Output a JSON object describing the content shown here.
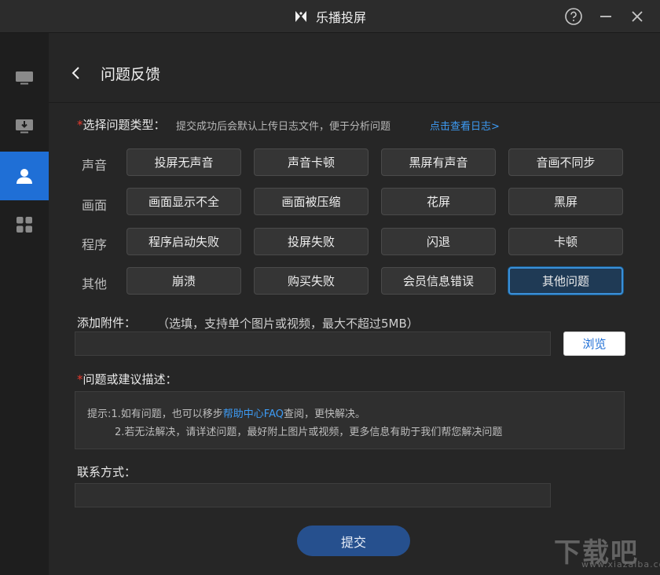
{
  "window": {
    "title": "乐播投屏",
    "logo_icon": "lebo-logo-icon",
    "controls": [
      "help-icon",
      "minimize-icon",
      "close-icon"
    ]
  },
  "sidebar": {
    "items": [
      {
        "icon": "monitor-icon",
        "active": false
      },
      {
        "icon": "download-monitor-icon",
        "active": false
      },
      {
        "icon": "user-icon",
        "active": true
      },
      {
        "icon": "apps-grid-icon",
        "active": false
      }
    ],
    "active_color": "#1f6fd6"
  },
  "header": {
    "title": "问题反馈"
  },
  "problem_type": {
    "required_mark": "*",
    "label": "选择问题类型：",
    "hint": "提交成功后会默认上传日志文件，便于分析问题",
    "log_link": "点击查看日志>",
    "categories": [
      {
        "name": "声音",
        "options": [
          "投屏无声音",
          "声音卡顿",
          "黑屏有声音",
          "音画不同步"
        ]
      },
      {
        "name": "画面",
        "options": [
          "画面显示不全",
          "画面被压缩",
          "花屏",
          "黑屏"
        ]
      },
      {
        "name": "程序",
        "options": [
          "程序启动失败",
          "投屏失败",
          "闪退",
          "卡顿"
        ]
      },
      {
        "name": "其他",
        "options": [
          "崩溃",
          "购买失败",
          "会员信息错误",
          "其他问题"
        ]
      }
    ],
    "selected": "其他问题"
  },
  "attachment": {
    "label": "添加附件：",
    "hint": "（选填，支持单个图片或视频，最大不超过5MB）",
    "value": "",
    "browse_label": "浏览"
  },
  "description": {
    "required_mark": "*",
    "label": "问题或建议描述：",
    "tip1_prefix": "提示:1.如有问题，也可以移步",
    "tip1_link": "帮助中心FAQ",
    "tip1_suffix": "查阅，更快解决。",
    "tip2": "2.若无法解决，请详述问题，最好附上图片或视频，更多信息有助于我们帮您解决问题"
  },
  "contact": {
    "label": "联系方式：",
    "value": ""
  },
  "submit_label": "提交",
  "watermark": {
    "text": "下载吧",
    "sub": "www.xiazaiba.com"
  }
}
